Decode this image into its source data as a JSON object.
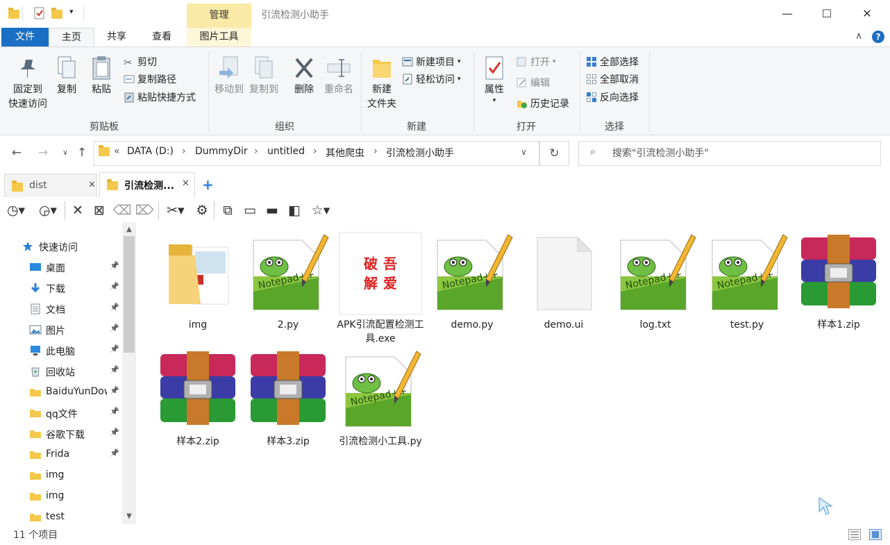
{
  "window": {
    "title": "引流检测小助手",
    "context_tab": "管理"
  },
  "ribbon_tabs": [
    "文件",
    "主页",
    "共享",
    "查看",
    "图片工具"
  ],
  "ribbon": {
    "clipboard": {
      "label": "剪贴板",
      "pin": "固定到\n快速访问",
      "copy": "复制",
      "paste": "粘贴",
      "cut": "剪切",
      "copy_path": "复制路径",
      "paste_shortcut": "粘贴快捷方式"
    },
    "organize": {
      "label": "组织",
      "move_to": "移动到",
      "copy_to": "复制到",
      "delete": "删除",
      "rename": "重命名"
    },
    "new": {
      "label": "新建",
      "new_folder": "新建\n文件夹",
      "new_item": "新建项目",
      "easy_access": "轻松访问"
    },
    "open": {
      "label": "打开",
      "properties": "属性",
      "open": "打开",
      "edit": "编辑",
      "history": "历史记录"
    },
    "select": {
      "label": "选择",
      "select_all": "全部选择",
      "select_none": "全部取消",
      "invert": "反向选择"
    }
  },
  "address": {
    "prefix": "«",
    "crumbs": [
      "DATA (D:)",
      "DummyDir",
      "untitled",
      "其他爬虫",
      "引流检测小助手"
    ]
  },
  "search": {
    "placeholder": "搜索\"引流检测小助手\""
  },
  "folder_tabs": [
    {
      "label": "dist",
      "active": false
    },
    {
      "label": "引流检测...",
      "active": true
    }
  ],
  "nav": {
    "items": [
      {
        "label": "快速访问",
        "icon": "star-icon",
        "pinned": false
      },
      {
        "label": "桌面",
        "icon": "desktop-icon",
        "pinned": true
      },
      {
        "label": "下载",
        "icon": "download-icon",
        "pinned": true
      },
      {
        "label": "文档",
        "icon": "document-icon",
        "pinned": true
      },
      {
        "label": "图片",
        "icon": "picture-icon",
        "pinned": true
      },
      {
        "label": "此电脑",
        "icon": "computer-icon",
        "pinned": true
      },
      {
        "label": "回收站",
        "icon": "recycle-bin-icon",
        "pinned": true
      },
      {
        "label": "BaiduYunDownload",
        "icon": "folder-icon",
        "pinned": true
      },
      {
        "label": "qq文件",
        "icon": "folder-icon",
        "pinned": true
      },
      {
        "label": "谷歌下载",
        "icon": "folder-icon",
        "pinned": true
      },
      {
        "label": "Frida",
        "icon": "folder-icon",
        "pinned": true
      },
      {
        "label": "img",
        "icon": "folder-icon",
        "pinned": false
      },
      {
        "label": "img",
        "icon": "folder-icon",
        "pinned": false
      },
      {
        "label": "test",
        "icon": "folder-icon",
        "pinned": false
      }
    ]
  },
  "files": [
    {
      "name": "img",
      "type": "folder"
    },
    {
      "name": "2.py",
      "type": "notepad"
    },
    {
      "name": "APK引流配置检测工具.exe",
      "type": "exe"
    },
    {
      "name": "demo.py",
      "type": "notepad"
    },
    {
      "name": "demo.ui",
      "type": "blank"
    },
    {
      "name": "log.txt",
      "type": "notepad"
    },
    {
      "name": "test.py",
      "type": "notepad"
    },
    {
      "name": "样本1.zip",
      "type": "zip"
    },
    {
      "name": "样本2.zip",
      "type": "zip"
    },
    {
      "name": "样本3.zip",
      "type": "zip"
    },
    {
      "name": "引流检测小工具.py",
      "type": "notepad"
    }
  ],
  "exe_icon_text": "吾爱破解",
  "status": {
    "count": "11 个项目"
  },
  "colors": {
    "file_tab": "#1a6fc4",
    "context_tab": "#fbe9a7",
    "ribbon_bg": "#f5f6f7"
  }
}
